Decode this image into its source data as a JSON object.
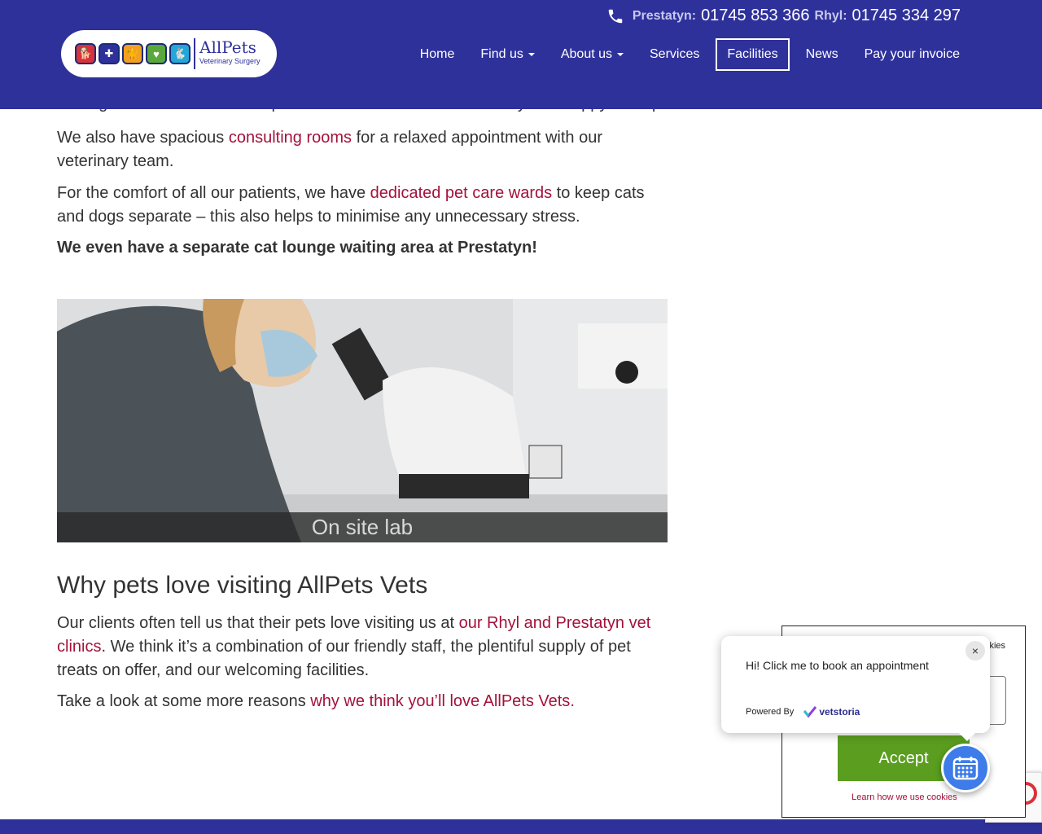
{
  "header": {
    "logo": {
      "brand": "AllPets",
      "subtitle": "Veterinary Surgery"
    },
    "phones": [
      {
        "label": "Prestatyn:",
        "number": "01745 853 366"
      },
      {
        "label": "Rhyl:",
        "number": "01745 334 297"
      }
    ],
    "nav": [
      {
        "label": "Home"
      },
      {
        "label": "Find us"
      },
      {
        "label": "About us"
      },
      {
        "label": "Services"
      },
      {
        "label": "Facilities"
      },
      {
        "label": "News"
      },
      {
        "label": "Pay your invoice"
      }
    ]
  },
  "content": {
    "clipped_line": "waiting areas. Just ask our experienced team for advice and they'll be happy to help.",
    "para1": {
      "before": "We also have spacious ",
      "link": "consulting rooms",
      "after": " for a relaxed appointment with our veterinary team."
    },
    "para2": {
      "before": "For the comfort of all our patients, we have ",
      "link": "dedicated pet care wards",
      "after": " to keep cats and dogs separate – this also helps to minimise any unnecessary stress."
    },
    "para3": "We even have a separate cat lounge waiting area at Prestatyn!",
    "image_caption": "On site lab",
    "heading": "Why pets love visiting AllPets Vets",
    "para4": {
      "before": "Our clients often tell us that their pets love visiting us at ",
      "link": "our Rhyl and Prestatyn vet clinics",
      "after": ". We think it’s a combination of our friendly staff, the plentiful supply of pet treats on offer, and our welcoming facilities."
    },
    "para5": {
      "before": "Take a look at some more reasons ",
      "link": "why we think you’ll love AllPets Vets",
      "after": "."
    }
  },
  "cookie": {
    "text_fragment": "kies",
    "accept_label": "Accept",
    "learn_link": "Learn how we use cookies"
  },
  "vetstoria": {
    "message": "Hi! Click me to book an appointment",
    "powered_by": "Powered By",
    "brand": "vetstoria",
    "close_label": "×"
  },
  "colors": {
    "header_bg": "#2f319b",
    "link": "#a4113a",
    "accept": "#5a9d1f",
    "fab": "#3d7ce9"
  }
}
